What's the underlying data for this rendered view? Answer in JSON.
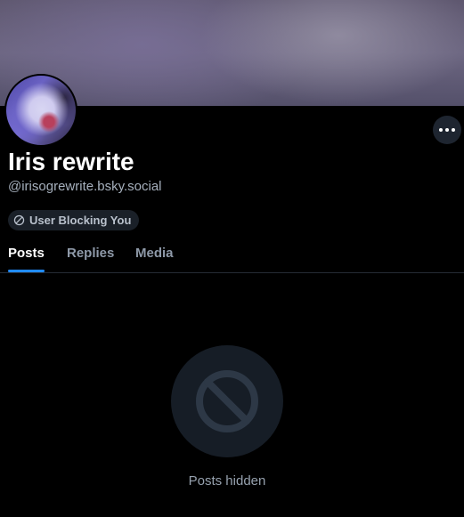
{
  "profile": {
    "display_name": "Iris rewrite",
    "handle": "@irisogrewrite.bsky.social",
    "badge_label": "User Blocking You",
    "badge_icon": "block-icon"
  },
  "header": {
    "more_icon": "more-horizontal-icon"
  },
  "tabs": [
    {
      "label": "Posts",
      "active": true
    },
    {
      "label": "Replies",
      "active": false
    },
    {
      "label": "Media",
      "active": false
    }
  ],
  "empty_state": {
    "icon": "block-icon",
    "message": "Posts hidden"
  },
  "colors": {
    "background": "#000000",
    "accent": "#208bfe",
    "muted_text": "#96a1ae",
    "badge_bg": "#1a2028"
  }
}
